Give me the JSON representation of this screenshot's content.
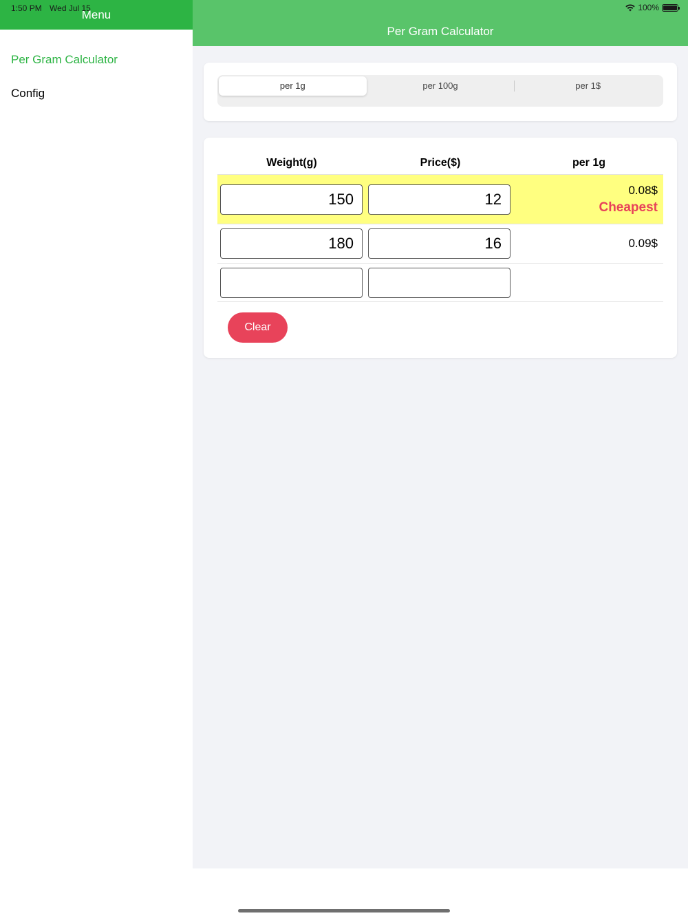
{
  "status_bar": {
    "time": "1:50 PM",
    "date": "Wed Jul 15",
    "battery": "100%",
    "battery_level": 1.0
  },
  "sidebar": {
    "title": "Menu",
    "items": [
      {
        "label": "Per Gram Calculator",
        "active": true
      },
      {
        "label": "Config",
        "active": false
      }
    ]
  },
  "main": {
    "title": "Per Gram Calculator",
    "segments": [
      {
        "label": "per 1g",
        "selected": true
      },
      {
        "label": "per 100g",
        "selected": false
      },
      {
        "label": "per 1$",
        "selected": false
      }
    ],
    "table": {
      "headers": [
        "Weight(g)",
        "Price($)",
        "per 1g"
      ],
      "rows": [
        {
          "weight": "150",
          "price": "12",
          "result": "0.08$",
          "tag": "Cheapest"
        },
        {
          "weight": "180",
          "price": "16",
          "result": "0.09$",
          "tag": ""
        },
        {
          "weight": "",
          "price": "",
          "result": "",
          "tag": ""
        }
      ]
    },
    "clear_label": "Clear"
  },
  "colors": {
    "sidebar_header": "#2db444",
    "main_header": "#59c46a",
    "active_text": "#2db444",
    "cheapest_row": "#ffff80",
    "accent_red": "#e8435a"
  }
}
